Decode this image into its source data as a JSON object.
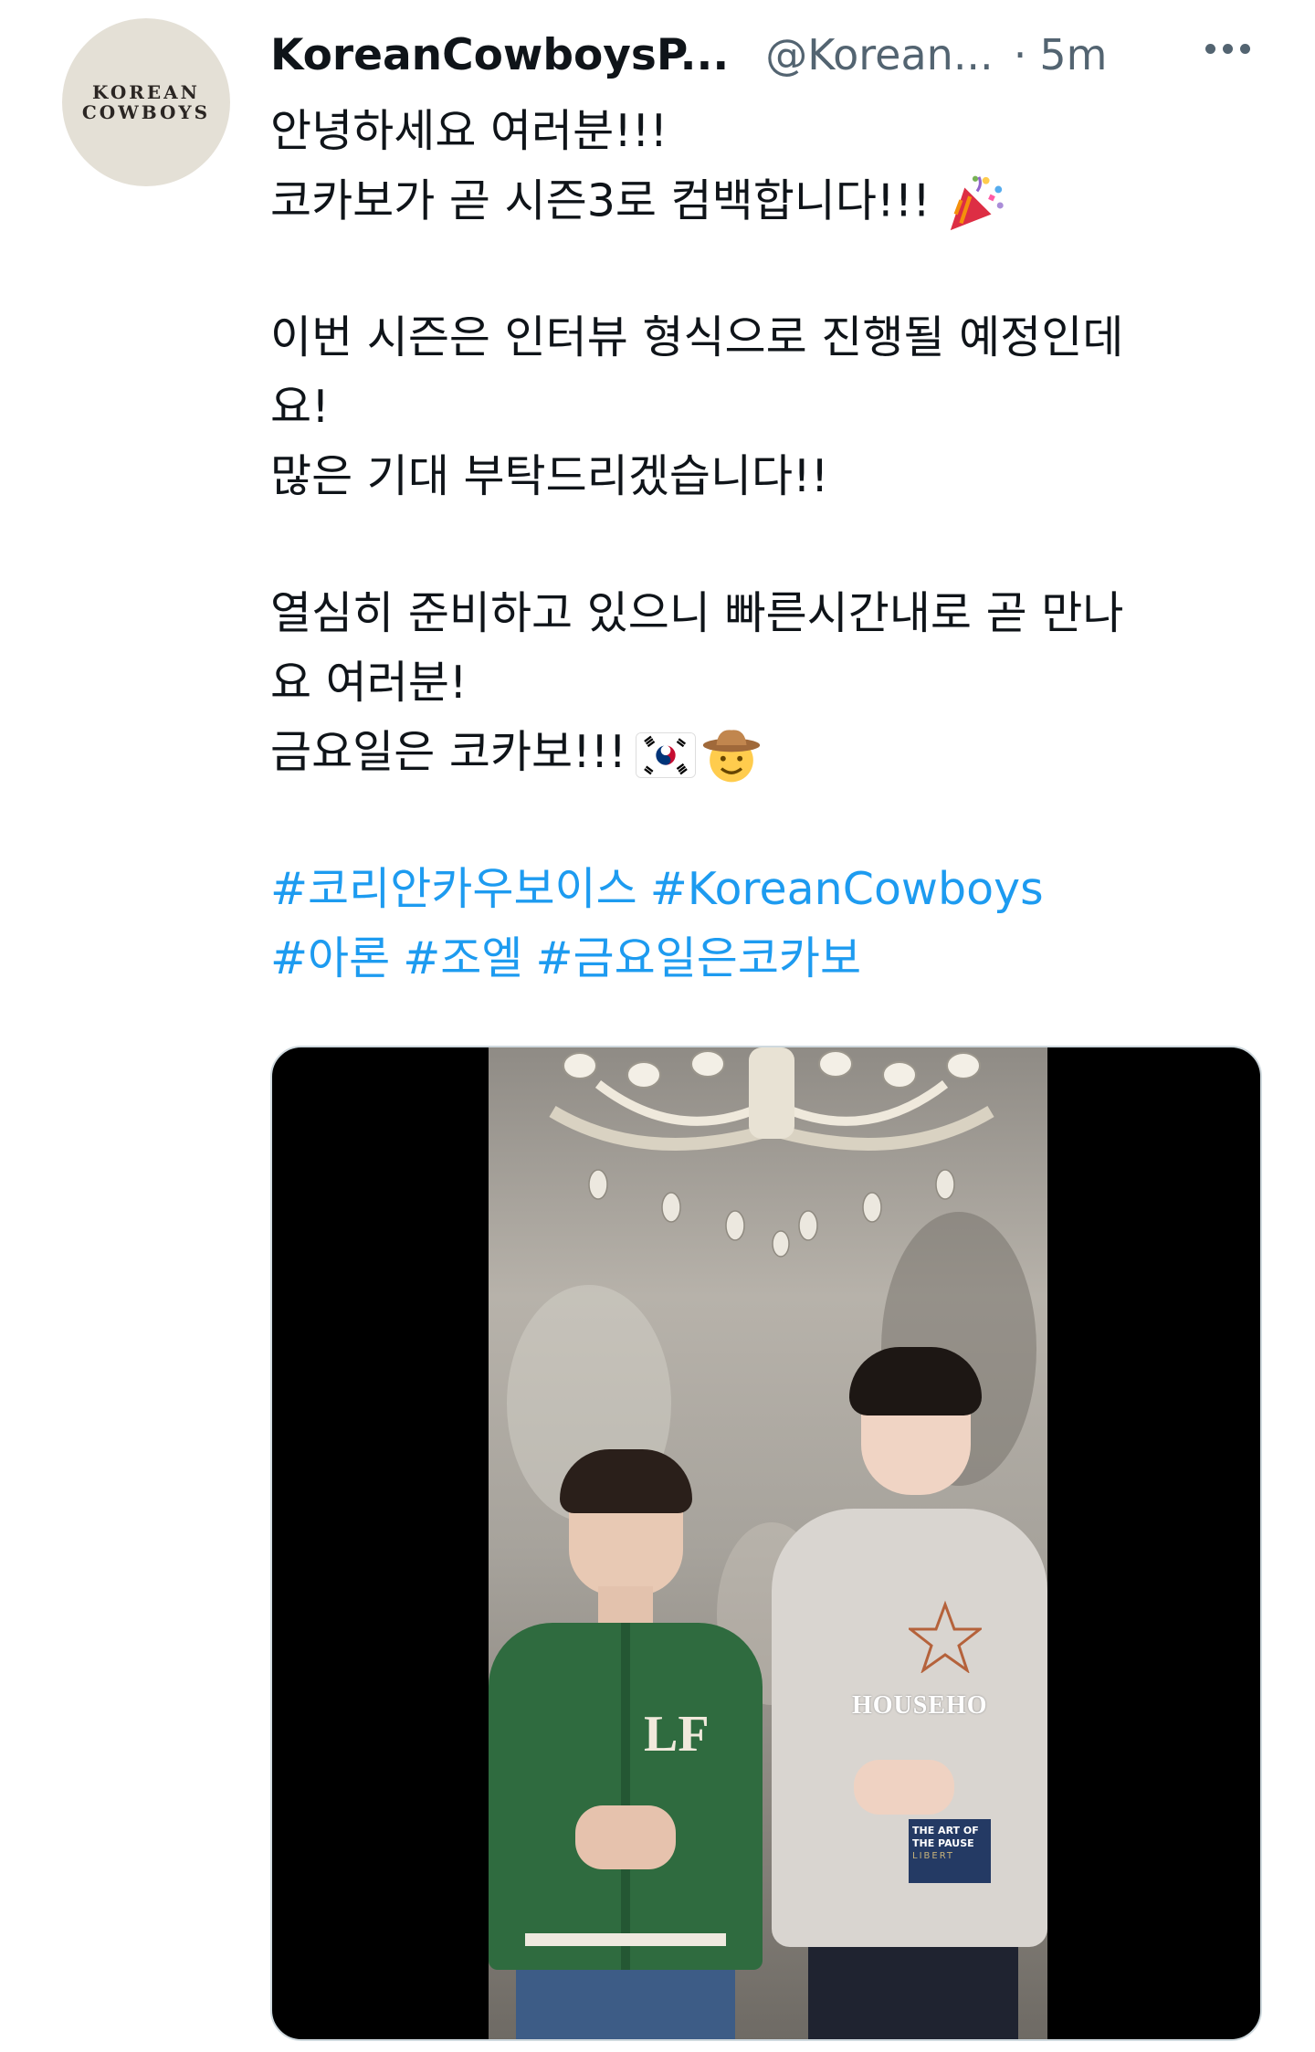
{
  "user": {
    "avatar_text_line1": "KOREAN",
    "avatar_text_line2": "COWBOYS",
    "display_name": "KoreanCowboysP...",
    "handle": "@Korean...",
    "separator": "·",
    "timestamp": "5m"
  },
  "tweet": {
    "lines": [
      "안녕하세요 여러분!!!",
      "코카보가 곧 시즌3로 컴백합니다!!!",
      "이번 시즌은 인터뷰 형식으로 진행될 예정인데",
      "요!",
      "많은 기대 부탁드리겠습니다!!",
      "열심히 준비하고 있으니 빠른시간내로 곧 만나",
      "요 여러분!",
      "금요일은 코카보!!!"
    ],
    "hashtags_line1": [
      "#코리안카우보이스",
      "#KoreanCowboys"
    ],
    "hashtags_line2": [
      "#아론",
      "#조엘",
      "#금요일은코카보"
    ]
  },
  "icons": {
    "more": "more-horizontal-icon",
    "emoji_1": "party-popper-icon",
    "emoji_2": "south-korea-flag-icon",
    "emoji_3": "cowboy-hat-face-icon"
  },
  "media": {
    "jacket_text": "LF",
    "hoodie_text": "HOUSEHO",
    "patch_line1": "THE ART OF",
    "patch_line2": "THE PAUSE",
    "patch_line3": "LIBERT"
  },
  "colors": {
    "link": "#1d9bf0",
    "secondary_text": "#536471",
    "primary_text": "#0f1419",
    "media_border": "#cfd9de"
  }
}
